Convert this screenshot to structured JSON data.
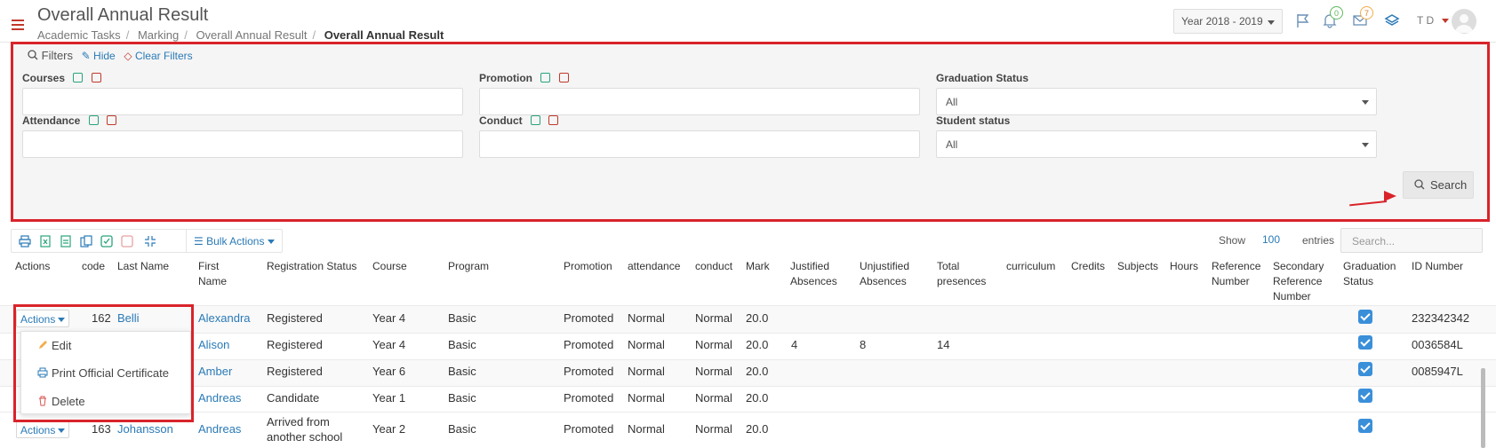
{
  "header": {
    "title": "Overall Annual Result",
    "breadcrumb": [
      "Academic Tasks",
      "Marking",
      "Overall Annual Result",
      "Overall Annual Result"
    ],
    "year": "Year 2018 - 2019",
    "notifications_count": "0",
    "messages_count": "7",
    "user_initials": "T D"
  },
  "filters": {
    "legend": "Filters",
    "hide": "Hide",
    "clear": "Clear Filters",
    "courses_label": "Courses",
    "promotion_label": "Promotion",
    "graduation_label": "Graduation Status",
    "graduation_value": "All",
    "attendance_label": "Attendance",
    "conduct_label": "Conduct",
    "student_status_label": "Student status",
    "student_status_value": "All",
    "search_button": "Search"
  },
  "toolbar": {
    "bulk_actions": "Bulk Actions",
    "show_label": "Show",
    "show_value": "100",
    "entries_label": "entries",
    "search_placeholder": "Search..."
  },
  "table": {
    "headers": {
      "actions": "Actions",
      "code": "code",
      "last_name": "Last Name",
      "first_name_1": "First",
      "first_name_2": "Name",
      "registration_status": "Registration Status",
      "course": "Course",
      "program": "Program",
      "promotion": "Promotion",
      "attendance": "attendance",
      "conduct": "conduct",
      "mark": "Mark",
      "justified_1": "Justified",
      "justified_2": "Absences",
      "unjustified_1": "Unjustified",
      "unjustified_2": "Absences",
      "total_1": "Total",
      "total_2": "presences",
      "curriculum": "curriculum",
      "credits": "Credits",
      "subjects": "Subjects",
      "hours": "Hours",
      "reference_1": "Reference",
      "reference_2": "Number",
      "secondary_1": "Secondary",
      "secondary_2": "Reference",
      "secondary_3": "Number",
      "graduation_1": "Graduation",
      "graduation_2": "Status",
      "id_number": "ID Number"
    },
    "actions_label": "Actions",
    "rows": [
      {
        "code": "162",
        "last_name": "Belli",
        "first_name": "Alexandra",
        "registration_status": "Registered",
        "course": "Year 4",
        "program": "Basic",
        "promotion": "Promoted",
        "attendance": "Normal",
        "conduct": "Normal",
        "mark": "20.0",
        "justified": "",
        "unjustified": "",
        "total": "",
        "id_number": "232342342"
      },
      {
        "code": "",
        "last_name": "",
        "first_name": "Alison",
        "registration_status": "Registered",
        "course": "Year 4",
        "program": "Basic",
        "promotion": "Promoted",
        "attendance": "Normal",
        "conduct": "Normal",
        "mark": "20.0",
        "justified": "4",
        "unjustified": "8",
        "total": "14",
        "id_number": "0036584L"
      },
      {
        "code": "",
        "last_name": "",
        "first_name": "Amber",
        "registration_status": "Registered",
        "course": "Year 6",
        "program": "Basic",
        "promotion": "Promoted",
        "attendance": "Normal",
        "conduct": "Normal",
        "mark": "20.0",
        "justified": "",
        "unjustified": "",
        "total": "",
        "id_number": "0085947L"
      },
      {
        "code": "",
        "last_name": "",
        "first_name": "Andreas",
        "registration_status": "Candidate",
        "course": "Year 1",
        "program": "Basic",
        "promotion": "Promoted",
        "attendance": "Normal",
        "conduct": "Normal",
        "mark": "20.0",
        "justified": "",
        "unjustified": "",
        "total": "",
        "id_number": ""
      },
      {
        "code": "163",
        "last_name": "Johansson",
        "first_name": "Andreas",
        "registration_status_1": "Arrived from",
        "registration_status_2": "another school",
        "course": "Year 2",
        "program": "Basic",
        "promotion": "Promoted",
        "attendance": "Normal",
        "conduct": "Normal",
        "mark": "20.0",
        "justified": "",
        "unjustified": "",
        "total": "",
        "id_number": ""
      }
    ]
  },
  "dropdown": {
    "edit": "Edit",
    "print": "Print Official Certificate",
    "delete": "Delete"
  }
}
